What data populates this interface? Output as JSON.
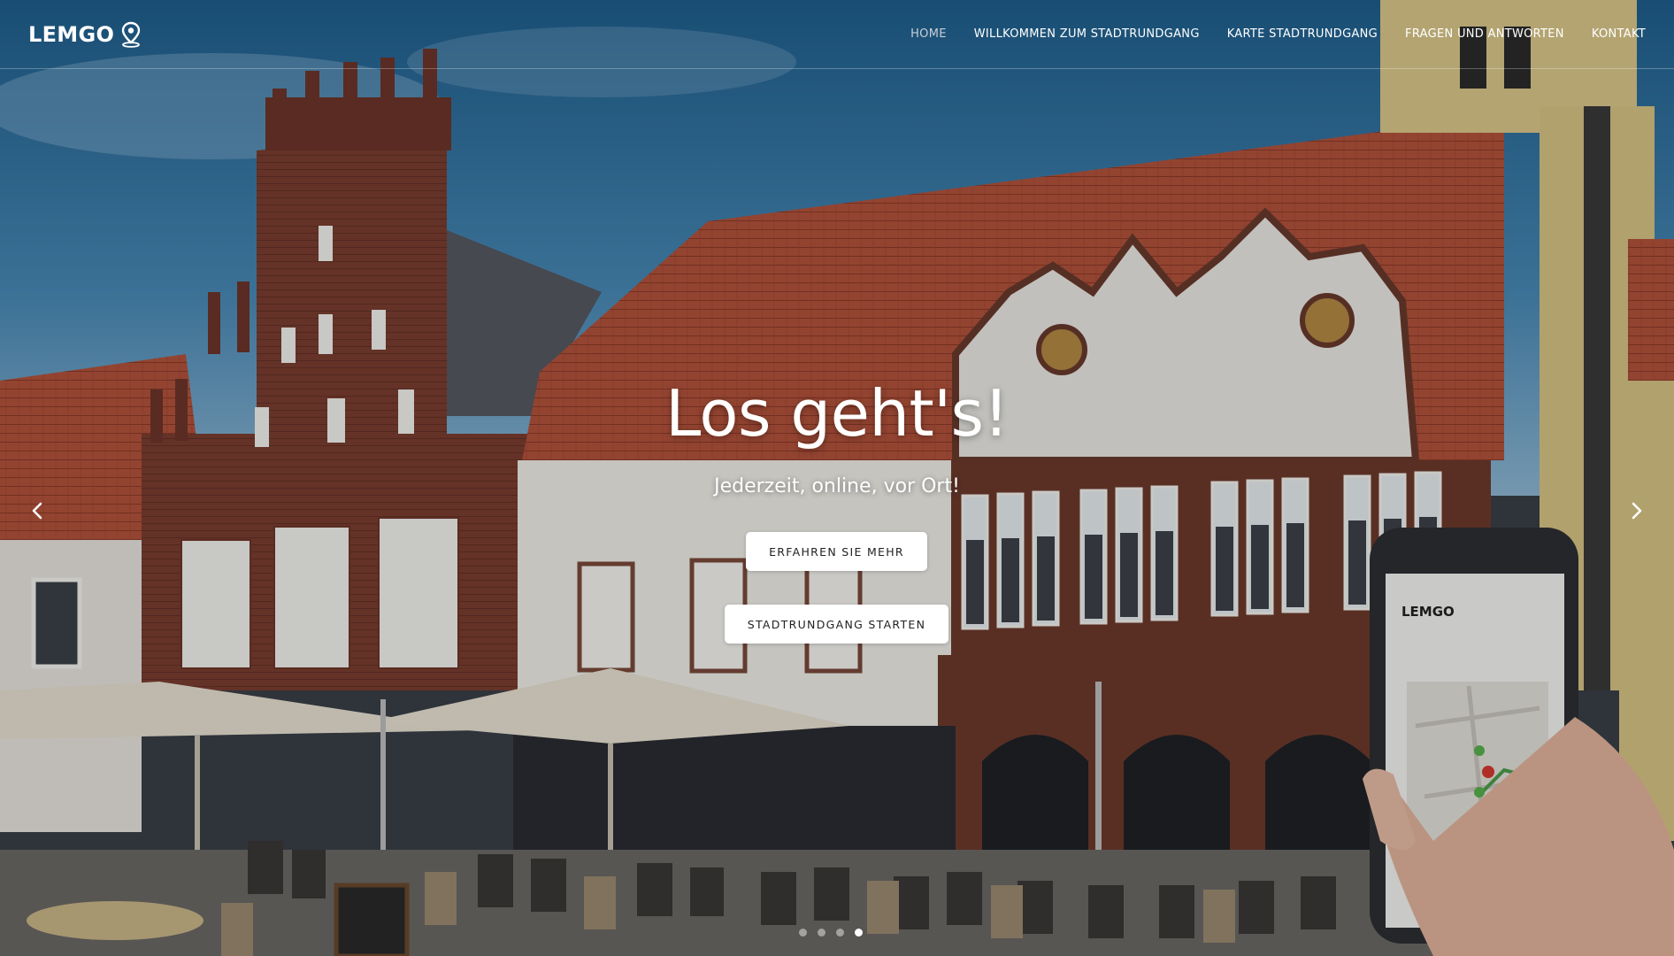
{
  "brand": {
    "name": "LEMGO",
    "icon": "map-pin-icon"
  },
  "nav": {
    "items": [
      {
        "label": "HOME",
        "active": true
      },
      {
        "label": "WILLKOMMEN ZUM STADTRUNDGANG",
        "active": false
      },
      {
        "label": "KARTE STADTRUNDGANG",
        "active": false
      },
      {
        "label": "FRAGEN UND ANTWORTEN",
        "active": false
      },
      {
        "label": "KONTAKT",
        "active": false
      }
    ]
  },
  "hero": {
    "title": "Los geht's!",
    "subtitle": "Jederzeit, online, vor Ort!",
    "button_more": "ERFAHREN SIE MEHR",
    "button_start": "STADTRUNDGANG STARTEN",
    "prev_icon": "chevron-left-icon",
    "next_icon": "chevron-right-icon",
    "slide_count": 4,
    "active_slide": 4
  },
  "phone": {
    "brand": "LEMGO"
  },
  "colors": {
    "sky": "#2f6e99",
    "roof": "#b4543c",
    "brick": "#7a3d30",
    "facade": "#f1efea",
    "nav_active": "#c9ced6"
  }
}
